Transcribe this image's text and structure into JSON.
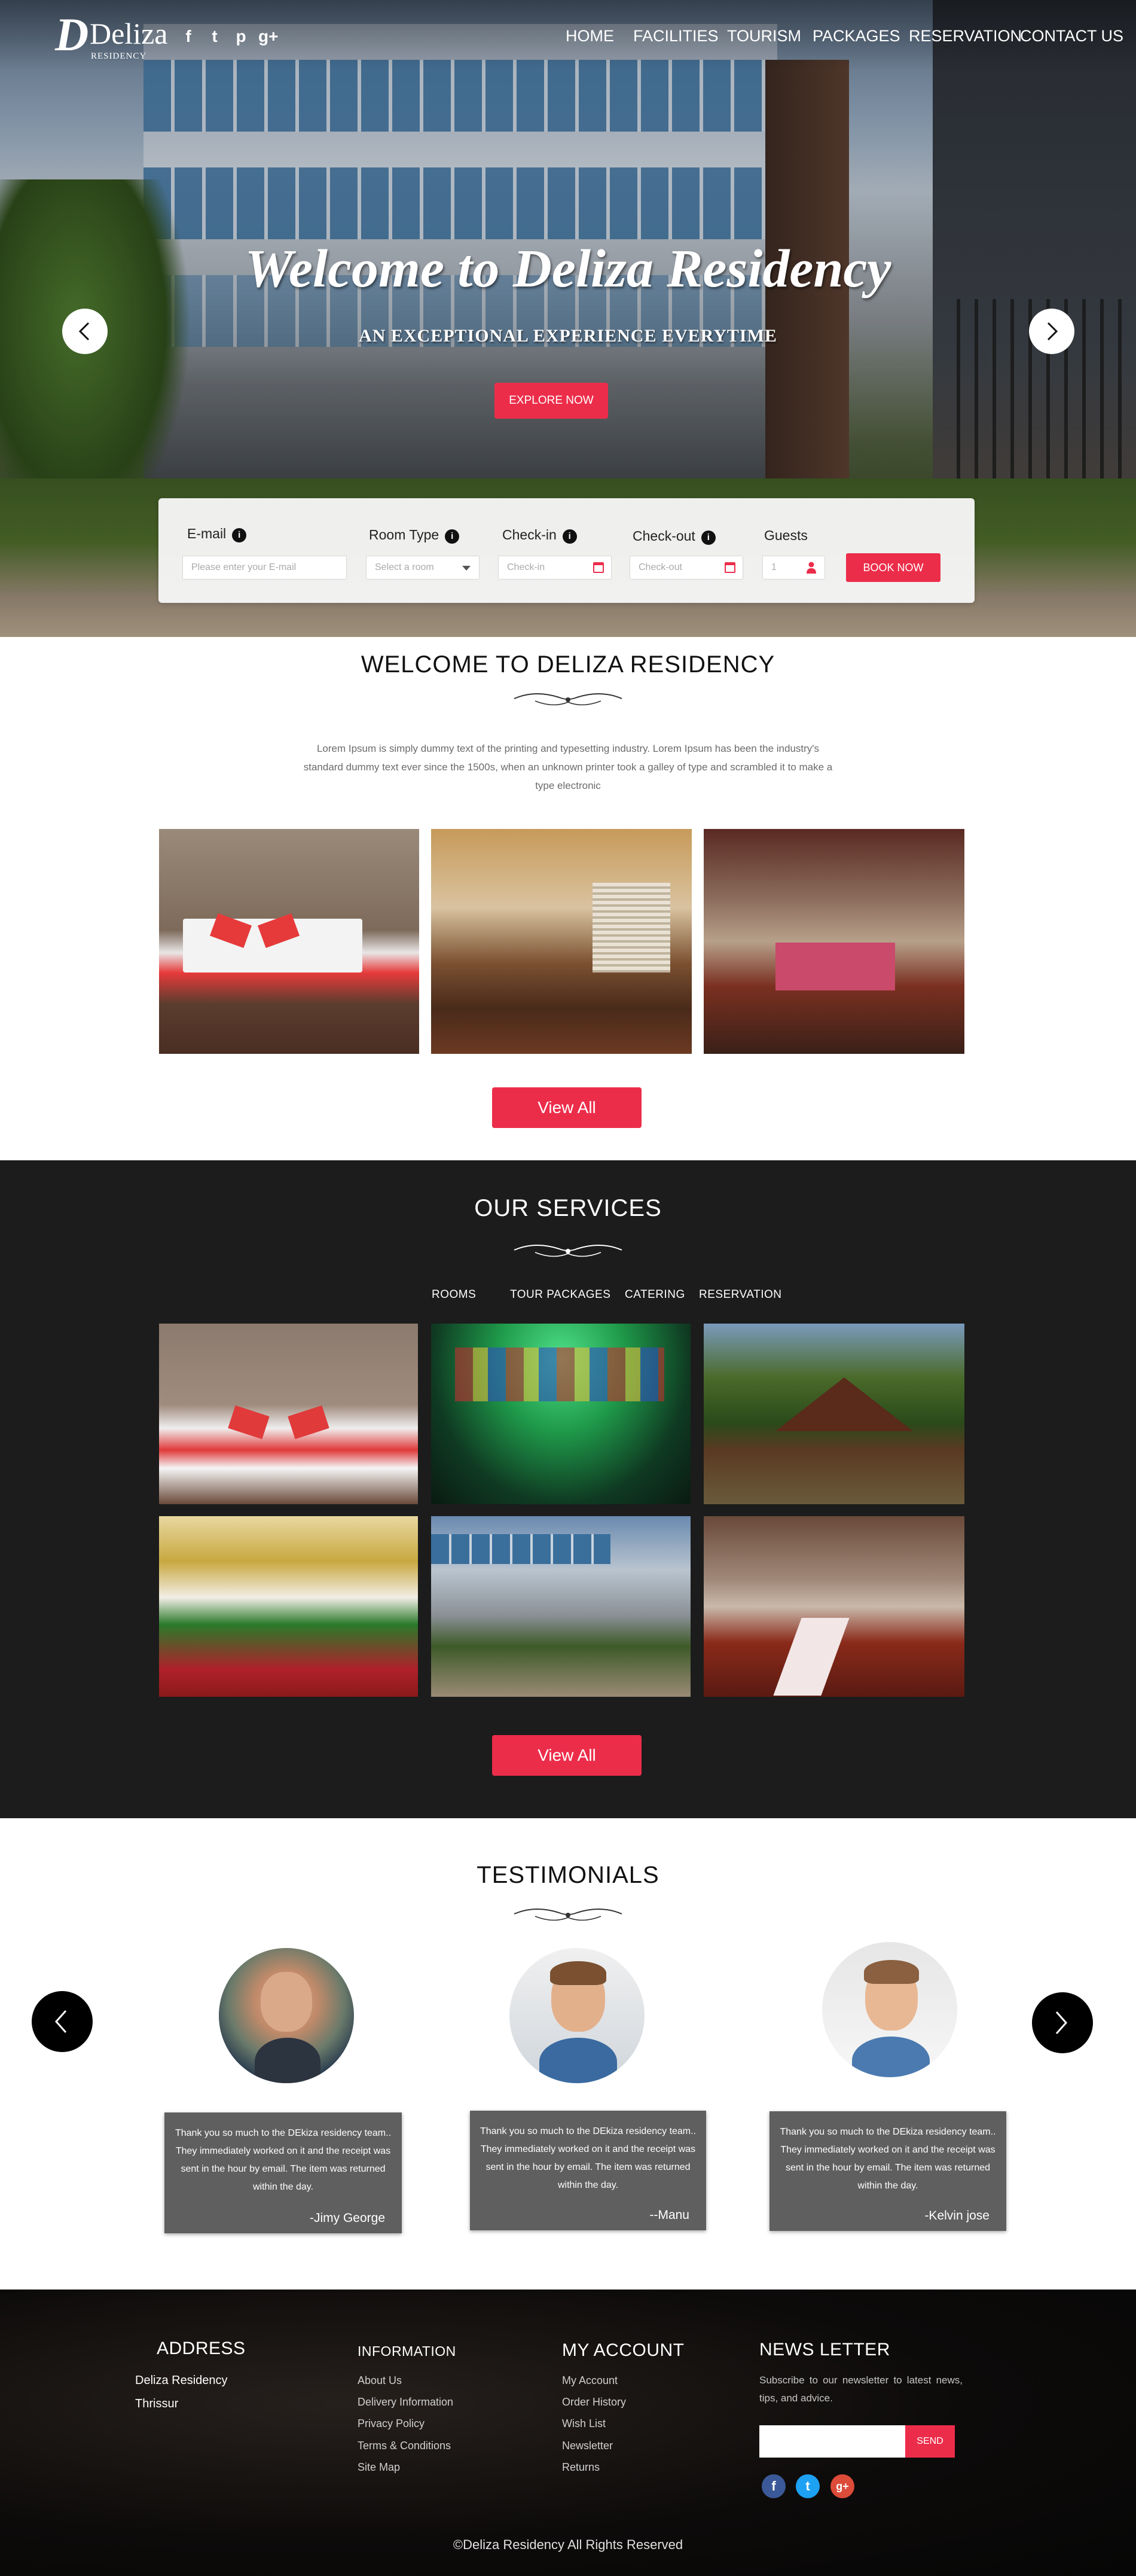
{
  "brand": {
    "logo_mark": "D",
    "name": "Deliza",
    "sub": "RESIDENCY"
  },
  "social_top": [
    "f",
    "t",
    "p",
    "g+"
  ],
  "nav": [
    "HOME",
    "FACILITIES",
    "TOURISM",
    "PACKAGES",
    "RESERVATION",
    "CONTACT US"
  ],
  "hero": {
    "title": "Welcome to Deliza Residency",
    "subtitle": "AN EXCEPTIONAL EXPERIENCE EVERYTIME",
    "cta": "EXPLORE NOW"
  },
  "booking": {
    "email_label": "E-mail",
    "email_placeholder": "Please enter your E-mail",
    "room_label": "Room Type",
    "room_placeholder": "Select a room",
    "checkin_label": "Check-in",
    "checkin_placeholder": "Check-in",
    "checkout_label": "Check-out",
    "checkout_placeholder": "Check-out",
    "guests_label": "Guests",
    "guests_value": "1",
    "submit": "BOOK NOW"
  },
  "welcome": {
    "title": "WELCOME TO DELIZA RESIDENCY",
    "text": "Lorem Ipsum is simply dummy text of the printing and typesetting industry. Lorem Ipsum has been the industry's standard dummy text ever since the 1500s, when an unknown printer took a galley of type and scrambled it to make a type electronic",
    "view_all": "View All"
  },
  "services": {
    "title": "OUR SERVICES",
    "tabs": [
      "ROOMS",
      "TOUR PACKAGES",
      "CATERING",
      "RESERVATION"
    ],
    "view_all": "View All"
  },
  "testimonials": {
    "title": "TESTIMONIALS",
    "items": [
      {
        "text": "Thank you so much to the DEkiza residency team.. They immediately worked on it and the receipt was sent in the hour by email. The item was returned within the day.",
        "author": "-Jimy George"
      },
      {
        "text": "Thank you so much to the DEkiza residency team.. They immediately worked on it and the receipt was sent in the hour by email. The item was returned within the day.",
        "author": "--Manu"
      },
      {
        "text": "Thank you so much to the DEkiza residency team.. They immediately worked on it and the receipt was sent in the hour by email. The item was returned within the day.",
        "author": "-Kelvin jose"
      }
    ]
  },
  "footer": {
    "address_title": "ADDRESS",
    "address_lines": [
      "Deliza Residency",
      "Thrissur"
    ],
    "info_title": "INFORMATION",
    "info_links": [
      "About Us",
      "Delivery Information",
      "Privacy Policy",
      "Terms & Conditions",
      "Site Map"
    ],
    "account_title": "MY ACCOUNT",
    "account_links": [
      "My Account",
      "Order History",
      "Wish List",
      "Newsletter",
      "Returns"
    ],
    "news_title": "NEWS LETTER",
    "news_text": "Subscribe to our newsletter to latest news, tips, and advice.",
    "news_button": "SEND",
    "social": [
      "f",
      "t",
      "g+"
    ],
    "copyright": "Deliza Residency All Rights Reserved",
    "copyright_symbol": "©"
  },
  "colors": {
    "accent": "#ec2d4a",
    "dark_section": "#1c1c1c",
    "card": "#5f5f5f"
  }
}
